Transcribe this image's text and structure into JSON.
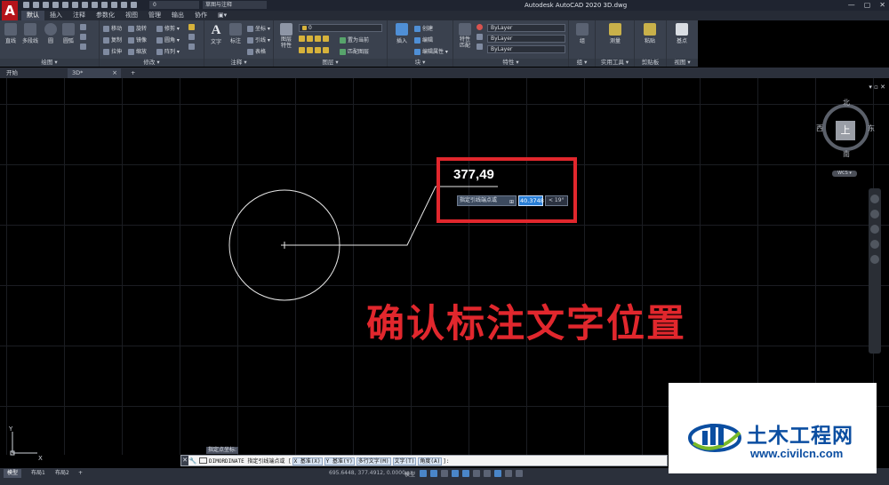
{
  "titlebar": {
    "app_logo": "A",
    "layer_combo": "0",
    "workspace": "草图与注释",
    "title": "Autodesk AutoCAD 2020    3D.dwg",
    "controls": [
      "—",
      "▢",
      "✕"
    ]
  },
  "ribbon_tabs": [
    "默认",
    "插入",
    "注释",
    "参数化",
    "视图",
    "管理",
    "输出",
    "协作",
    "▣▾"
  ],
  "ribbon": {
    "draw": {
      "title": "绘图 ▾",
      "big": [
        "直线",
        "多段线",
        "圆",
        "圆弧"
      ]
    },
    "modify": {
      "title": "修改 ▾",
      "items": [
        "移动",
        "旋转",
        "修剪 ▾",
        "复制",
        "镜像",
        "圆角 ▾",
        "拉伸",
        "缩放",
        "阵列 ▾"
      ]
    },
    "annotation": {
      "title": "注释 ▾",
      "big": [
        "文字",
        "标注"
      ],
      "items": [
        "坐标 ▾",
        "引线 ▾",
        "表格"
      ]
    },
    "layers": {
      "title": "图层 ▾",
      "big": "图层特性",
      "combo": "0",
      "items": [
        "置为当前",
        "匹配图层"
      ]
    },
    "block": {
      "title": "块 ▾",
      "big": "插入",
      "items": [
        "创建",
        "编辑",
        "编辑属性 ▾"
      ]
    },
    "properties": {
      "title": "特性 ▾",
      "big": "特性匹配",
      "combos": [
        "ByLayer",
        "ByLayer",
        "ByLayer"
      ]
    },
    "groups": {
      "title": "组 ▾",
      "big": "组"
    },
    "utilities": {
      "title": "实用工具 ▾",
      "big": "测量"
    },
    "clipboard": {
      "title": "剪贴板",
      "big": "粘贴"
    },
    "view": {
      "title": "视图 ▾",
      "big": "基点"
    }
  },
  "file_tabs": {
    "start": "开始",
    "doc": "3D*",
    "close": "×",
    "add": "+"
  },
  "drawing_controls": "▾  ▫  ✕",
  "viewcube": {
    "north": "北",
    "south": "南",
    "east": "东",
    "west": "西",
    "face": "上",
    "wcs": "WCS ▾"
  },
  "dimension_input": {
    "value": "377,49",
    "prompt": "指定引线端点或",
    "prompt_icon": "⊞",
    "input": "40.3748",
    "angle": "< 19°"
  },
  "annotation_text": "确认标注文字位置",
  "ucs": {
    "x": "X",
    "y": "Y"
  },
  "command": {
    "hint": "指定点坐标:",
    "close": "✕",
    "wrench": "🔧",
    "prefix": "DIMORDINATE 指定引线端点或 [",
    "options": [
      "X 基准(X)",
      "Y 基准(Y)",
      "多行文字(M)",
      "文字(T)",
      "角度(A)"
    ],
    "suffix": "]:"
  },
  "statusbar": {
    "layouts": [
      "模型",
      "布局1",
      "布局2",
      "+"
    ],
    "coords": "695.6448, 377.4912, 0.0000",
    "mode": "模型"
  },
  "watermark": {
    "title": "土木工程网",
    "url": "www.civilcn.com"
  },
  "colors": {
    "highlight": "#e1272d",
    "input_active": "#2a7fd6",
    "watermark_blue": "#0b4ea1"
  }
}
